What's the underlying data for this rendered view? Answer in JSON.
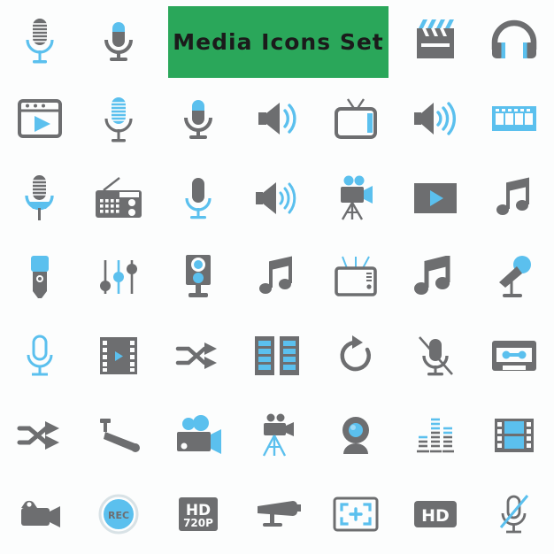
{
  "banner": {
    "title": "Media Icons Set",
    "background_color": "#2aa75a",
    "text_color": "#1b1b1b"
  },
  "palette": {
    "gray": "#6d6e70",
    "blue": "#5bc0ee",
    "background": "#fcfdfd",
    "white": "#ffffff"
  },
  "grid": {
    "columns": 7,
    "rows": 7,
    "total_icons": 43
  },
  "icon_labels": {
    "badge_hd_720p_line1": "HD",
    "badge_hd_720p_line2": "720P",
    "badge_rec": "REC",
    "badge_hd": "HD"
  },
  "rows": [
    {
      "row": 1,
      "icons": [
        {
          "name": "vintage-microphone-icon",
          "label": "Vintage microphone"
        },
        {
          "name": "microphone-blue-top-icon",
          "label": "Microphone"
        },
        {
          "name": "empty-slot",
          "label": ""
        },
        {
          "name": "empty-slot",
          "label": ""
        },
        {
          "name": "empty-slot",
          "label": ""
        },
        {
          "name": "clapperboard-icon",
          "label": "Clapperboard"
        },
        {
          "name": "headphones-icon",
          "label": "Headphones"
        }
      ]
    },
    {
      "row": 2,
      "icons": [
        {
          "name": "video-player-window-icon",
          "label": "Video player window"
        },
        {
          "name": "vintage-microphone-blue-icon",
          "label": "Vintage microphone"
        },
        {
          "name": "microphone-stand-icon",
          "label": "Microphone on stand"
        },
        {
          "name": "speaker-volume-low-icon",
          "label": "Speaker volume low"
        },
        {
          "name": "television-icon",
          "label": "Television"
        },
        {
          "name": "speaker-volume-high-icon",
          "label": "Speaker volume high"
        },
        {
          "name": "film-strip-icon",
          "label": "Film strip"
        }
      ]
    },
    {
      "row": 3,
      "icons": [
        {
          "name": "vintage-microphone-base-icon",
          "label": "Vintage microphone with base"
        },
        {
          "name": "radio-icon",
          "label": "Radio"
        },
        {
          "name": "microphone-outline-icon",
          "label": "Microphone outline"
        },
        {
          "name": "speaker-waves-icon",
          "label": "Speaker with waves"
        },
        {
          "name": "movie-camera-tripod-icon",
          "label": "Movie camera on tripod"
        },
        {
          "name": "play-button-icon",
          "label": "Play button"
        },
        {
          "name": "music-note-icon",
          "label": "Music note"
        }
      ]
    },
    {
      "row": 4,
      "icons": [
        {
          "name": "handheld-microphone-icon",
          "label": "Handheld microphone"
        },
        {
          "name": "equalizer-sliders-icon",
          "label": "Equalizer sliders"
        },
        {
          "name": "studio-monitor-icon",
          "label": "Studio monitor speaker"
        },
        {
          "name": "music-note-single-icon",
          "label": "Music note"
        },
        {
          "name": "retro-tv-icon",
          "label": "Retro television"
        },
        {
          "name": "music-notes-double-icon",
          "label": "Double music note"
        },
        {
          "name": "microphone-desk-stand-icon",
          "label": "Microphone on desk stand"
        }
      ]
    },
    {
      "row": 5,
      "icons": [
        {
          "name": "microphone-line-icon",
          "label": "Microphone outline"
        },
        {
          "name": "film-frame-play-icon",
          "label": "Film frame with play"
        },
        {
          "name": "shuffle-icon",
          "label": "Shuffle"
        },
        {
          "name": "film-reels-icon",
          "label": "Film reels"
        },
        {
          "name": "repeat-icon",
          "label": "Repeat"
        },
        {
          "name": "microphone-muted-icon",
          "label": "Microphone muted"
        },
        {
          "name": "cassette-tape-icon",
          "label": "Cassette tape"
        }
      ]
    },
    {
      "row": 6,
      "icons": [
        {
          "name": "shuffle-arrows-icon",
          "label": "Shuffle arrows"
        },
        {
          "name": "cctv-camera-icon",
          "label": "CCTV camera"
        },
        {
          "name": "video-camera-icon",
          "label": "Video camera"
        },
        {
          "name": "camera-tripod-icon",
          "label": "Camera on tripod"
        },
        {
          "name": "webcam-icon",
          "label": "Webcam"
        },
        {
          "name": "equalizer-bars-icon",
          "label": "Equalizer bars"
        },
        {
          "name": "film-strip-blue-icon",
          "label": "Film strip"
        }
      ]
    },
    {
      "row": 7,
      "icons": [
        {
          "name": "camcorder-icon",
          "label": "Camcorder"
        },
        {
          "name": "rec-badge-icon",
          "label": "REC badge"
        },
        {
          "name": "hd-720p-badge-icon",
          "label": "HD 720P badge"
        },
        {
          "name": "security-camera-icon",
          "label": "Security camera"
        },
        {
          "name": "fullscreen-focus-icon",
          "label": "Fullscreen focus frame"
        },
        {
          "name": "hd-badge-icon",
          "label": "HD badge"
        },
        {
          "name": "microphone-mute-slash-icon",
          "label": "Microphone mute"
        }
      ]
    }
  ]
}
